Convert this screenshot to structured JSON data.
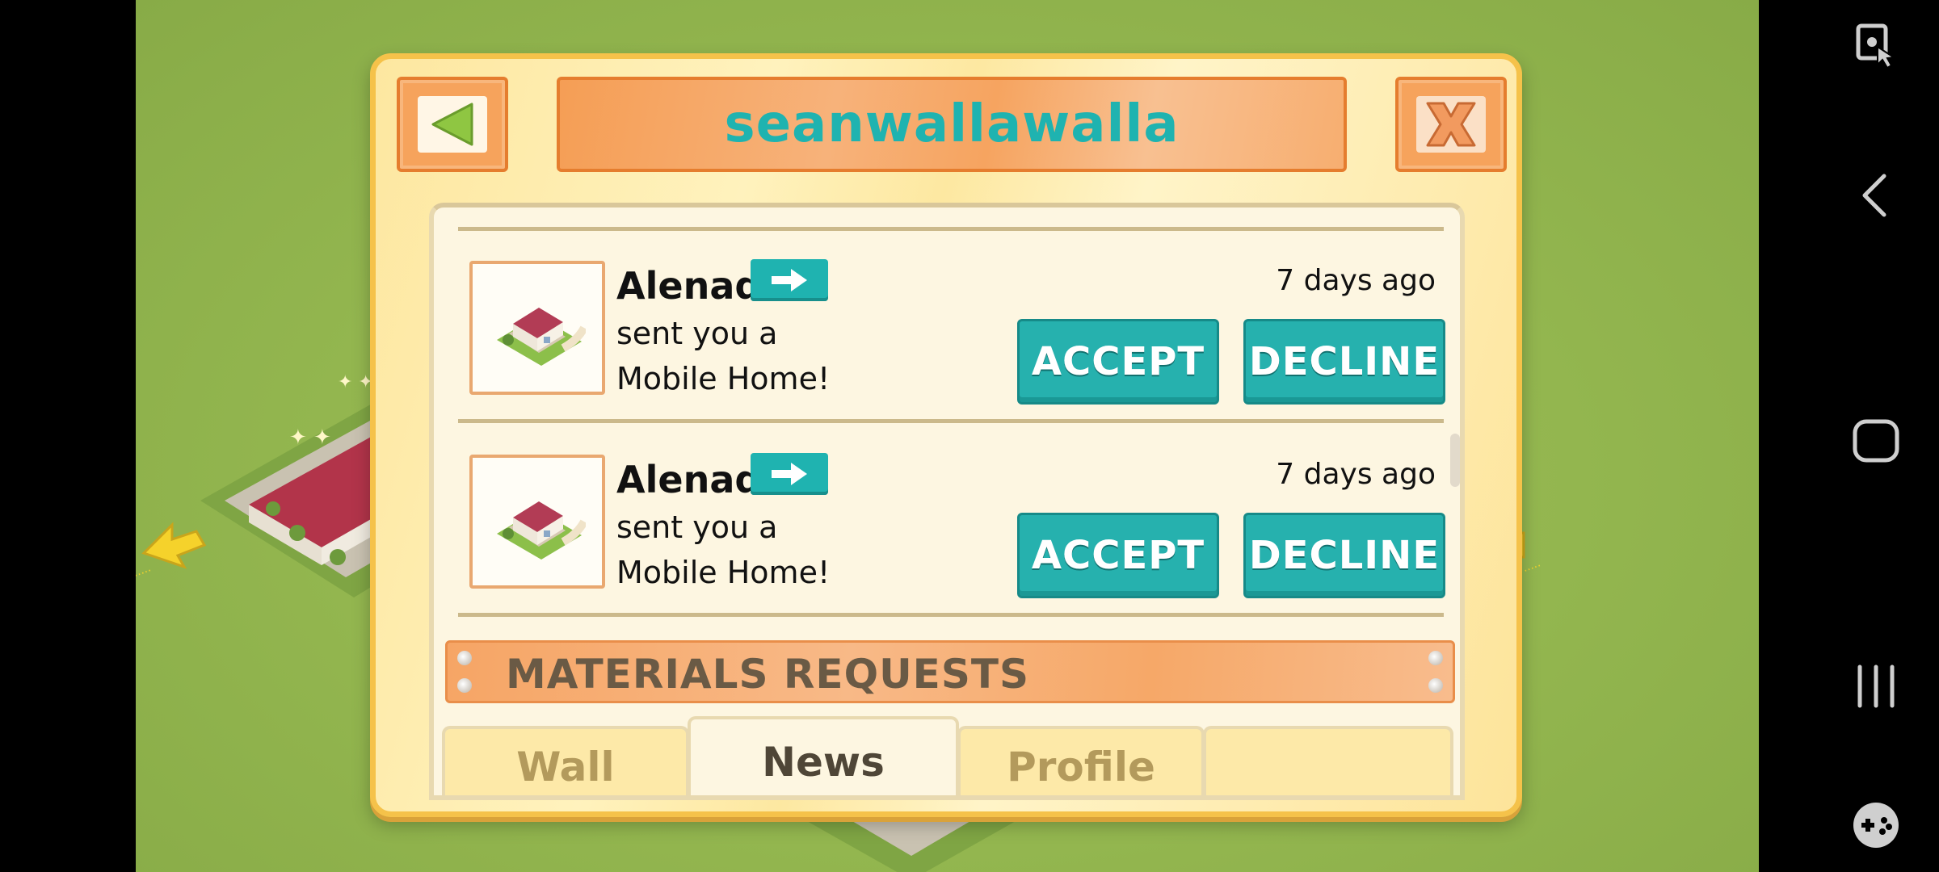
{
  "dialog": {
    "title": "seanwallawalla"
  },
  "news_items": [
    {
      "sender": "Alenad",
      "message_line1": "sent you a",
      "message_line2": "Mobile Home!",
      "time": "7 days ago",
      "accept_label": "ACCEPT",
      "decline_label": "DECLINE"
    },
    {
      "sender": "Alenad",
      "message_line1": "sent you a",
      "message_line2": "Mobile Home!",
      "time": "7 days ago",
      "accept_label": "ACCEPT",
      "decline_label": "DECLINE"
    }
  ],
  "section_header": "MATERIALS REQUESTS",
  "tabs": [
    {
      "label": "Wall",
      "active": false
    },
    {
      "label": "News",
      "active": true
    },
    {
      "label": "Profile",
      "active": false
    }
  ],
  "icons": {
    "back": "triangle-left-icon",
    "close": "x-icon",
    "arrow": "arrow-right-icon",
    "thumb": "mobile-home-icon",
    "nav": [
      "screen-touch-icon",
      "back-chevron-icon",
      "home-square-icon",
      "recents-icon",
      "gamepad-icon"
    ]
  },
  "colors": {
    "title_text": "#1fb3b0",
    "action_button": "#26b1ae",
    "title_bar": "#f6a460",
    "dialog_bg": "#fde7a0"
  }
}
